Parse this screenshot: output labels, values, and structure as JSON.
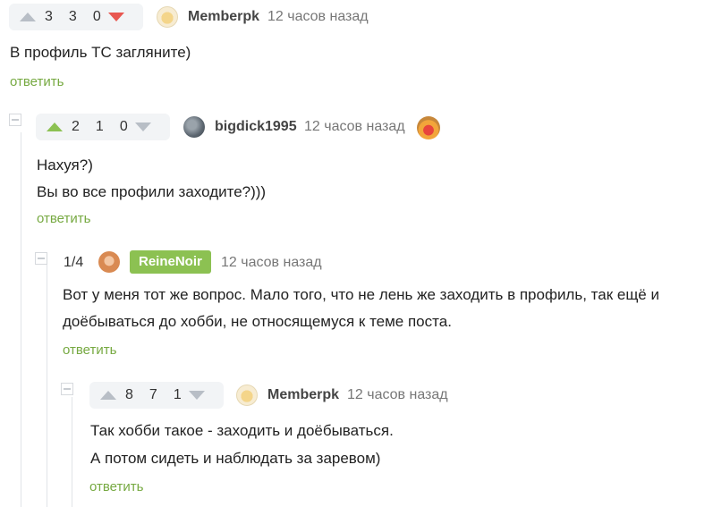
{
  "comments": [
    {
      "votes": {
        "up": "3",
        "rating": "3",
        "down": "0"
      },
      "author": "Memberpk",
      "time": "12 часов назад",
      "lines": [
        "В профиль ТС загляните)"
      ],
      "reply": "ответить"
    },
    {
      "votes": {
        "up": "2",
        "rating": "1",
        "down": "0"
      },
      "author": "bigdick1995",
      "time": "12 часов назад",
      "lines": [
        "Нахуя?)",
        "Вы во все профили заходите?)))"
      ],
      "reply": "ответить"
    },
    {
      "counter": "1/4",
      "author": "ReineNoir",
      "time": "12 часов назад",
      "lines": [
        "Вот у меня тот же вопрос. Мало того, что не лень же заходить в профиль, так ещё и",
        "доёбываться до хобби, не относящемуся к теме поста."
      ],
      "reply": "ответить"
    },
    {
      "votes": {
        "up": "8",
        "rating": "7",
        "down": "1"
      },
      "author": "Memberpk",
      "time": "12 часов назад",
      "lines": [
        "Так хобби такое - заходить и доёбываться.",
        "А потом сидеть и наблюдать за заревом)"
      ],
      "reply": "ответить"
    }
  ],
  "colors": {
    "accent": "#8cc152",
    "down": "#e85750",
    "link": "#76a941"
  }
}
